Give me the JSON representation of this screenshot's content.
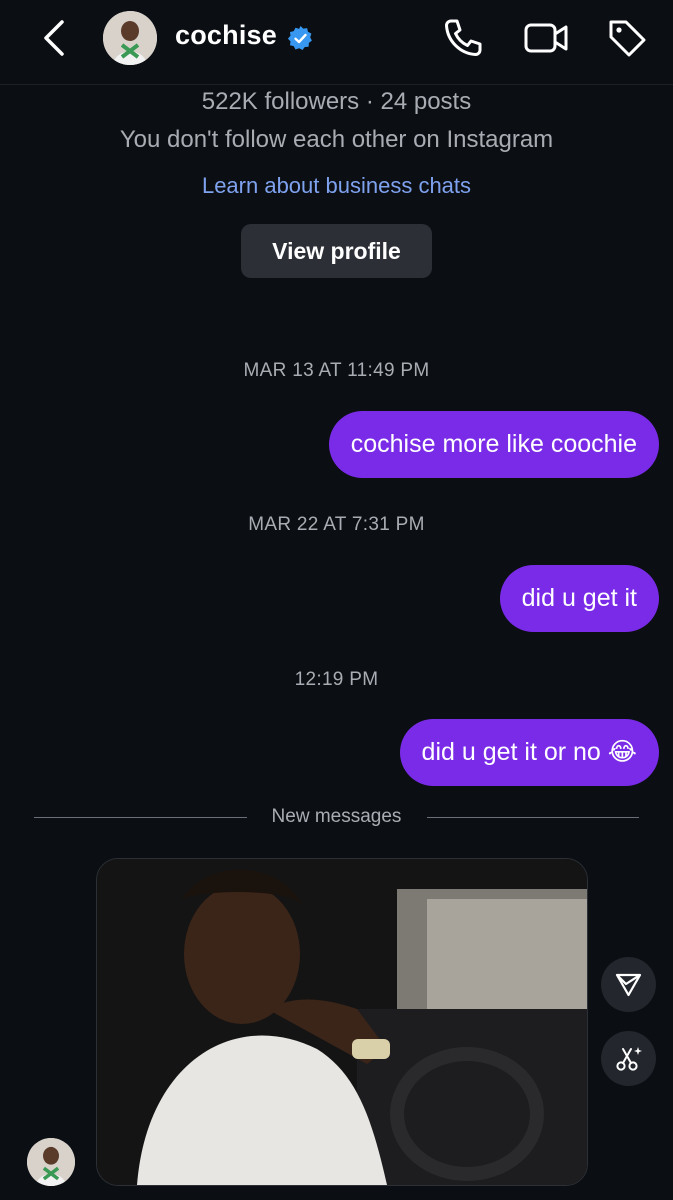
{
  "header": {
    "username": "cochise",
    "icons": [
      "back-chevron-icon",
      "verified-badge-icon",
      "phone-icon",
      "video-camera-icon",
      "tag-icon"
    ]
  },
  "profile_info": {
    "followers_line": "522K followers · 24 posts",
    "follow_status": "You don't follow each other on Instagram",
    "learn_link": "Learn about business chats",
    "view_profile_label": "View profile"
  },
  "messages": [
    {
      "timestamp": "MAR 13 AT 11:49 PM",
      "text": "cochise more like coochie"
    },
    {
      "timestamp": "MAR 22 AT 7:31 PM",
      "text": "did u get it"
    },
    {
      "timestamp": "12:19 PM",
      "text": "did u get it or no 😂"
    }
  ],
  "new_messages_label": "New messages",
  "colors": {
    "background": "#0b0f14",
    "outgoing_bubble": "#7a2be8",
    "link": "#7fa2ef",
    "verified": "#3897f0",
    "secondary_text": "#a9adb3"
  }
}
